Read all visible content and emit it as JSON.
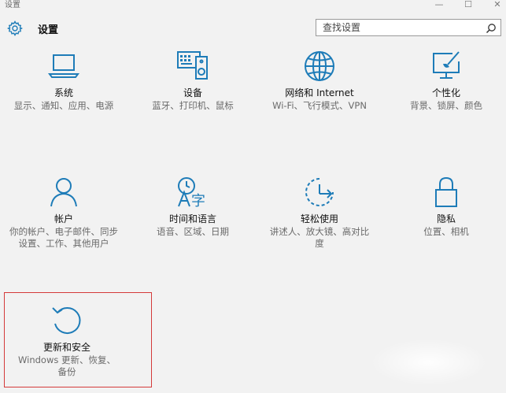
{
  "window": {
    "title": "设置",
    "controls": {
      "minimize": "—",
      "maximize": "☐",
      "close": "✕"
    }
  },
  "header": {
    "title": "设置",
    "search_placeholder": "查找设置"
  },
  "tiles": [
    {
      "icon": "laptop-icon",
      "name": "系统",
      "desc": "显示、通知、应用、电源"
    },
    {
      "icon": "keyboard-speaker-icon",
      "name": "设备",
      "desc": "蓝牙、打印机、鼠标"
    },
    {
      "icon": "globe-icon",
      "name": "网络和 Internet",
      "desc": "Wi-Fi、飞行模式、VPN"
    },
    {
      "icon": "paint-monitor-icon",
      "name": "个性化",
      "desc": "背景、锁屏、颜色"
    },
    {
      "icon": "person-icon",
      "name": "帐户",
      "desc": "你的帐户、电子邮件、同步设置、工作、其他用户"
    },
    {
      "icon": "time-language-icon",
      "name": "时间和语言",
      "desc": "语音、区域、日期"
    },
    {
      "icon": "ease-of-access-icon",
      "name": "轻松使用",
      "desc": "讲述人、放大镜、高对比度"
    },
    {
      "icon": "lock-icon",
      "name": "隐私",
      "desc": "位置、相机"
    },
    {
      "icon": "update-icon",
      "name": "更新和安全",
      "desc": "Windows 更新、恢复、备份"
    }
  ],
  "colors": {
    "accent": "#1e7cb8",
    "background": "#f2f2f2",
    "highlight_border": "#d43a3a"
  }
}
